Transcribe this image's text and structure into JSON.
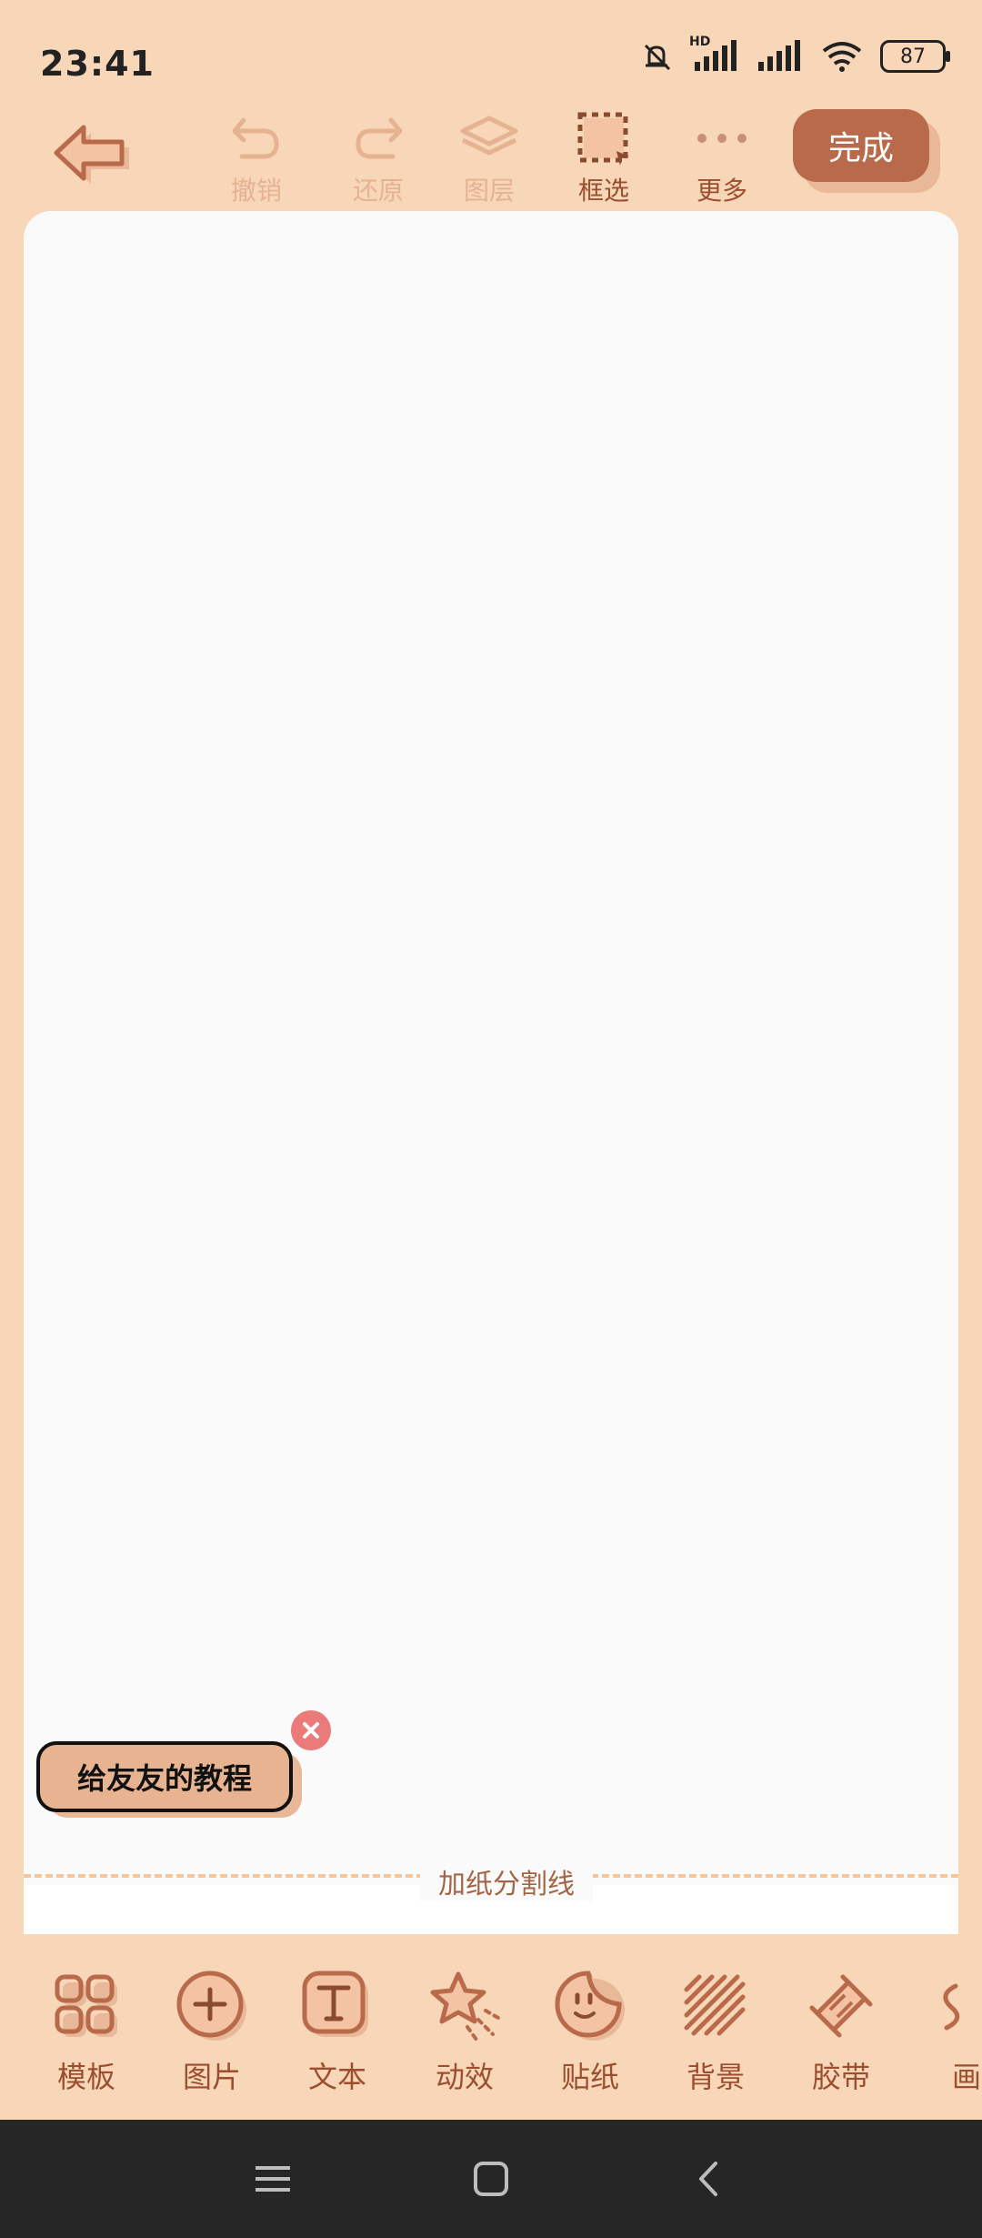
{
  "status_bar": {
    "time": "23:41",
    "battery": "87",
    "network": "HD"
  },
  "toolbar": {
    "undo": "撤销",
    "redo": "还原",
    "layers": "图层",
    "select": "框选",
    "more": "更多",
    "done": "完成"
  },
  "canvas": {
    "tag": "给友友的教程",
    "divider": "加纸分割线"
  },
  "bottom_tools": {
    "items": [
      {
        "label": "模板",
        "icon": "template-grid-icon"
      },
      {
        "label": "图片",
        "icon": "add-image-icon"
      },
      {
        "label": "文本",
        "icon": "text-icon"
      },
      {
        "label": "动效",
        "icon": "effects-star-icon"
      },
      {
        "label": "贴纸",
        "icon": "sticker-icon"
      },
      {
        "label": "背景",
        "icon": "background-icon"
      },
      {
        "label": "胶带",
        "icon": "tape-icon"
      },
      {
        "label": "画",
        "icon": "draw-icon"
      }
    ]
  },
  "colors": {
    "background": "#F8D6B8",
    "accent": "#B86A4A",
    "canvas": "#FAFAFA",
    "close": "#EB7A7A"
  }
}
